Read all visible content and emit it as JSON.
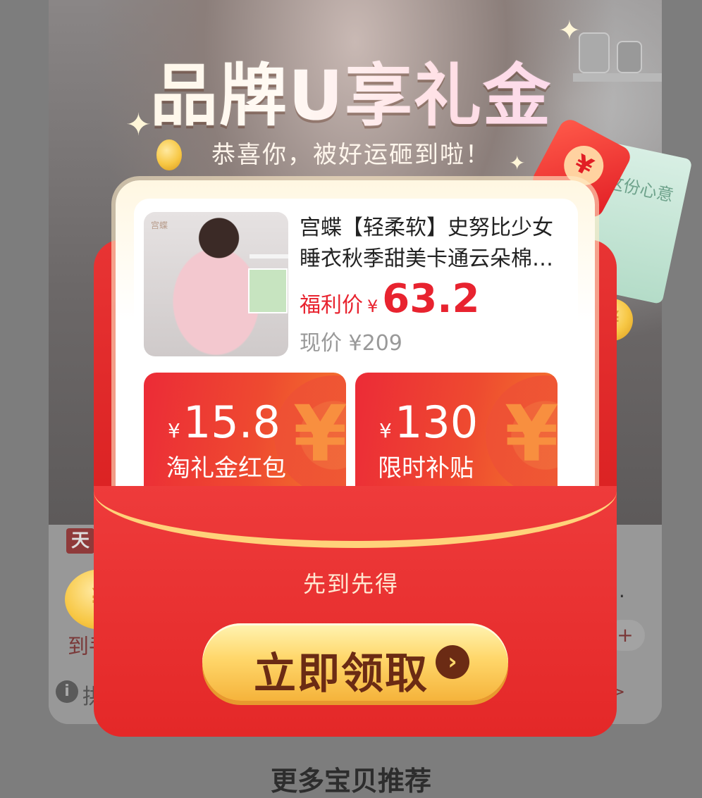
{
  "background": {
    "badge": "天",
    "left_text": "到手",
    "info_text": "拱",
    "dots": "..",
    "pill": "+",
    "arrow": ">",
    "bottom_title": "更多宝贝推荐"
  },
  "popup": {
    "title": "品牌U享礼金",
    "subtitle": "恭喜你，被好运砸到啦！",
    "product": {
      "title_line1": "宫蝶【轻柔软】史努比少女",
      "title_line2": "睡衣秋季甜美卡通云朵棉…",
      "price_label": "福利价",
      "currency": "¥",
      "price": "63.2",
      "orig_label": "现价",
      "orig_price": "¥209",
      "image_logo": "宫蝶"
    },
    "coupons": [
      {
        "currency": "¥",
        "amount": "15.8",
        "label": "淘礼金红包"
      },
      {
        "currency": "¥",
        "amount": "130",
        "label": "限时补贴"
      }
    ],
    "tagline": "先到先得",
    "claim_button": "立即领取",
    "gift_box_text": "这份心意"
  },
  "colors": {
    "accent_red": "#e8232f",
    "envelope_red": "#e42828",
    "button_gold": "#ffd76b",
    "button_text": "#6b2b14"
  }
}
